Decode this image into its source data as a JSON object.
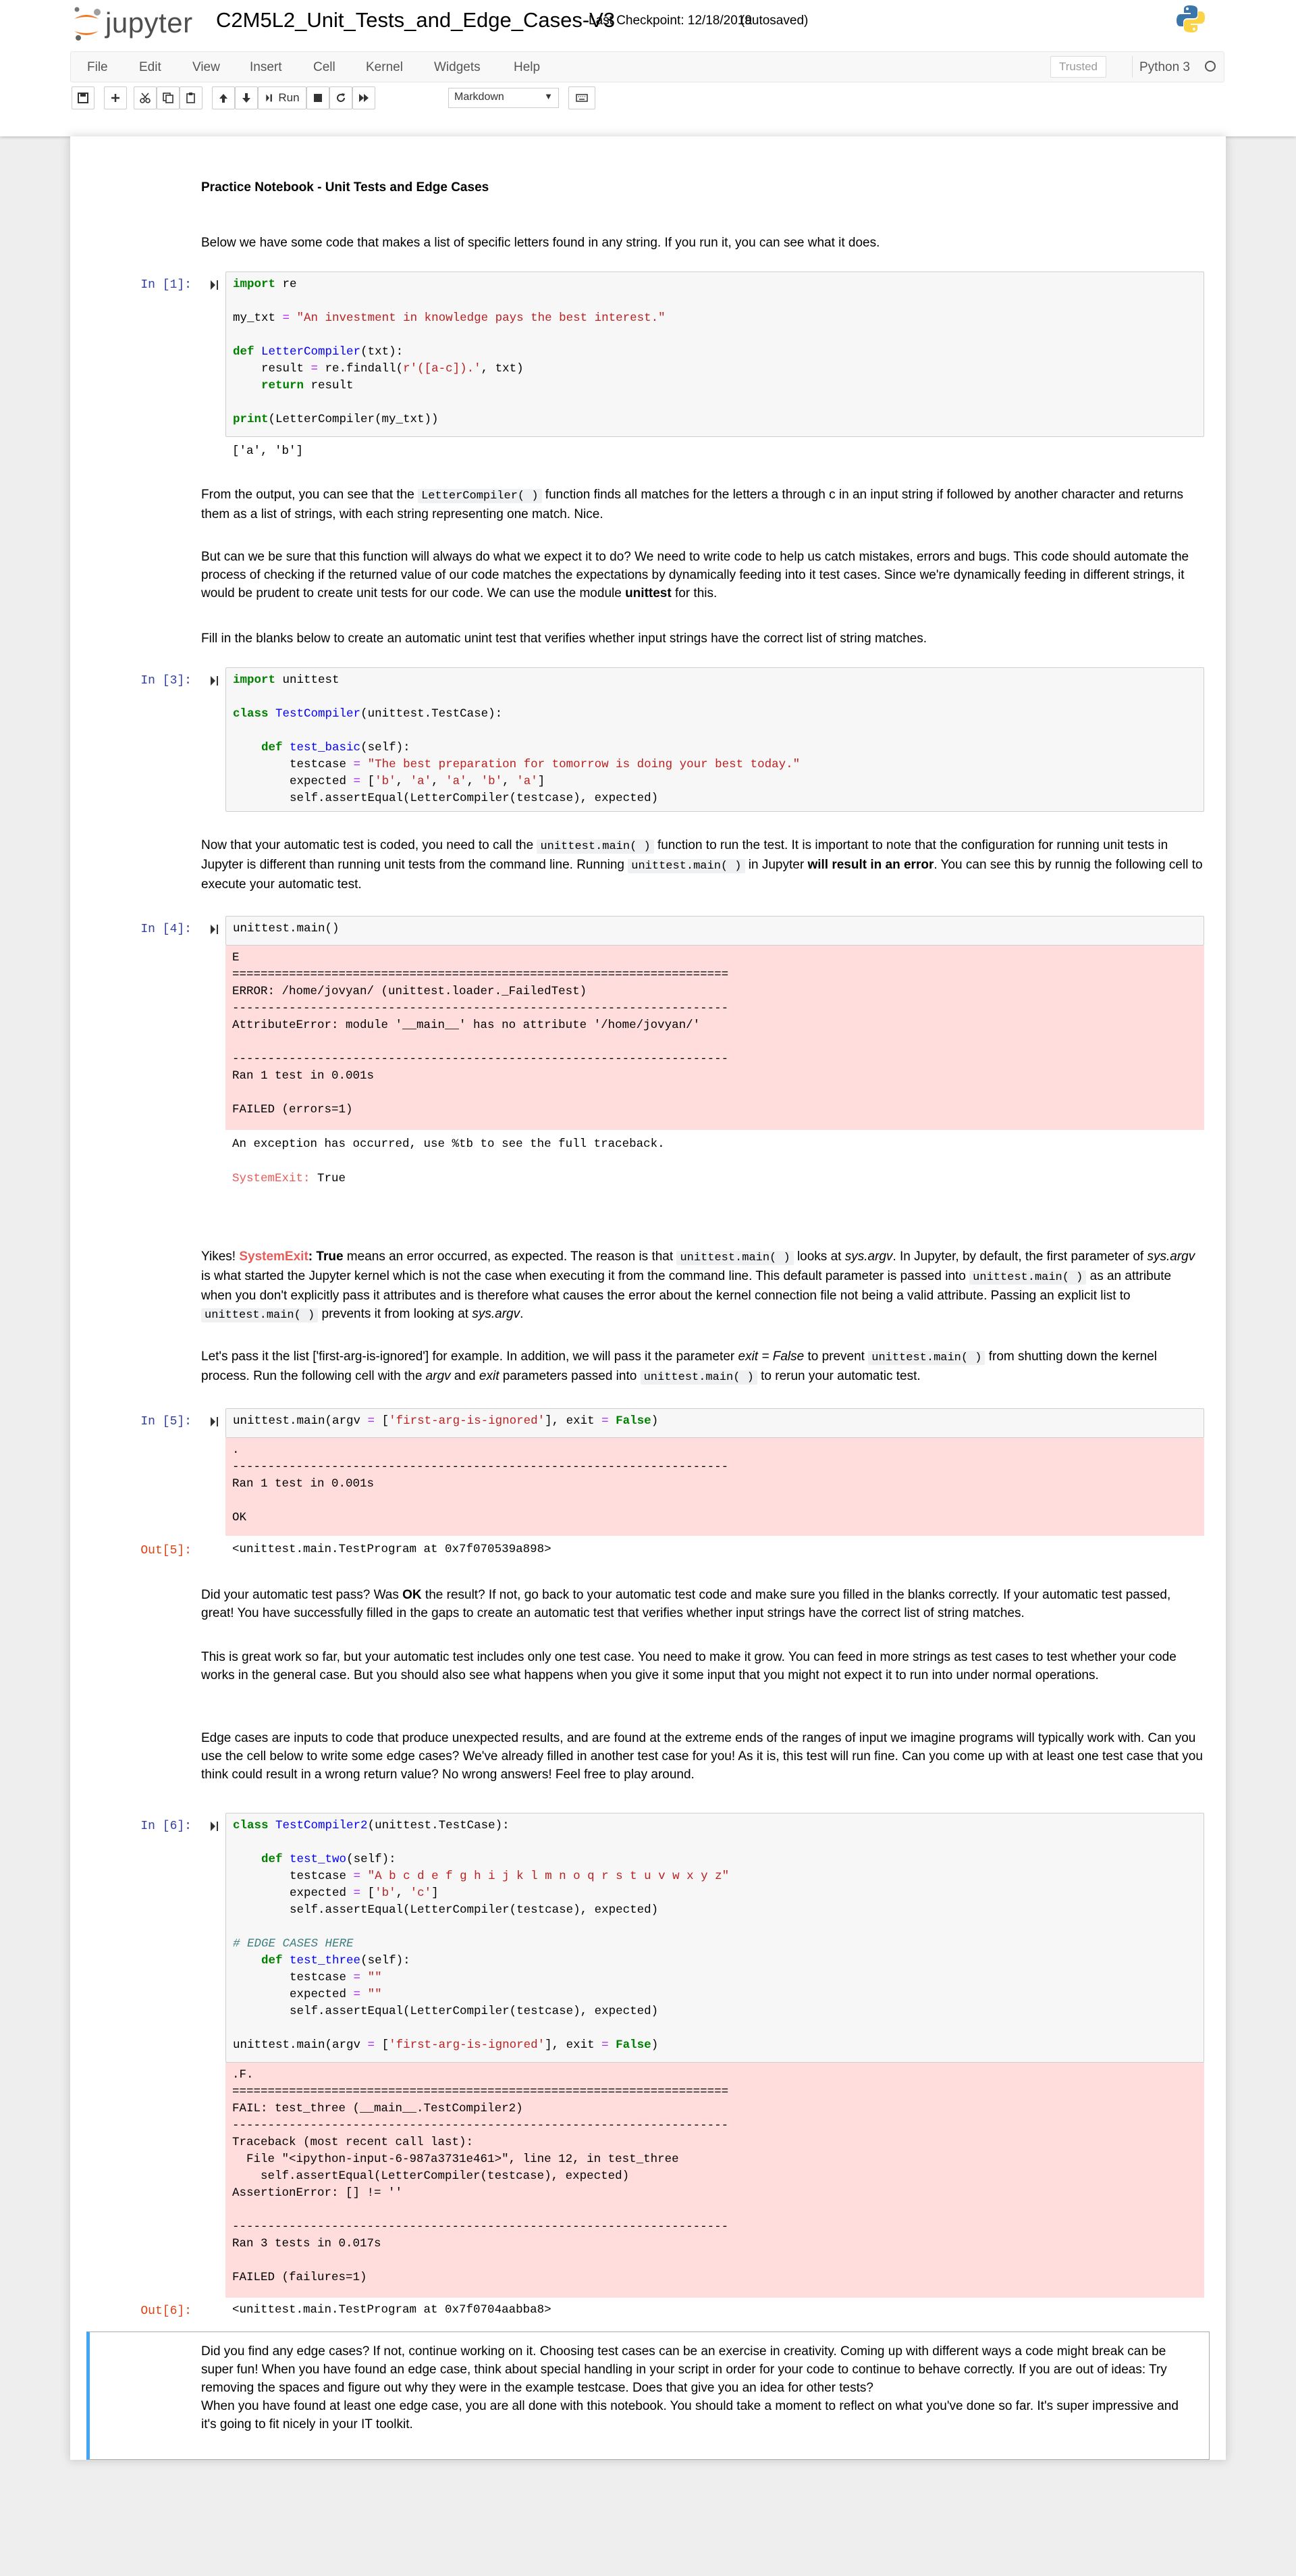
{
  "header": {
    "logo_text": "jupyter",
    "notebook_name": "C2M5L2_Unit_Tests_and_Edge_Cases-V3",
    "checkpoint": "Last Checkpoint: 12/18/2019",
    "autosave": "(autosaved)"
  },
  "menu": {
    "items": [
      "File",
      "Edit",
      "View",
      "Insert",
      "Cell",
      "Kernel",
      "Widgets",
      "Help"
    ],
    "trusted": "Trusted",
    "kernel": "Python 3"
  },
  "toolbar": {
    "run_label": "Run",
    "cell_type": "Markdown",
    "icons": [
      "save-icon",
      "plus-icon",
      "cut-icon",
      "copy-icon",
      "paste-icon",
      "arrow-up-icon",
      "arrow-down-icon",
      "run-icon",
      "stop-icon",
      "restart-icon",
      "fast-forward-icon",
      "keyboard-icon"
    ]
  },
  "cells": {
    "title": "Practice Notebook - Unit Tests and Edge Cases",
    "intro": "Below we have some code that makes a list of specific letters found in any string. If you run it, you can see what it does.",
    "c1_prompt": "In [1]:",
    "c1_out": "['a', 'b']",
    "md2_a": "From the output, you can see that the ",
    "md2_code": "LetterCompiler( )",
    "md2_b": " function finds all matches for the letters a through c in an input string if followed by another character and returns them as a list of strings, with each string representing one match. Nice.",
    "md3_a": "But can we be sure that this function will always do what we expect it to do? We need to write code to help us catch mistakes, errors and bugs. This code should automate the process of checking if the returned value of our code matches the expectations by dynamically feeding into it test cases. Since we're dynamically feeding in different strings, it would be prudent to create unit tests for our code. We can use the module ",
    "md3_bold": "unittest",
    "md3_b": " for this.",
    "md4": "Fill in the blanks below to create an automatic unint test that verifies whether input strings have the correct list of string matches.",
    "c3_prompt": "In [3]:",
    "md5_a": "Now that your automatic test is coded, you need to call the ",
    "md5_code1": "unittest.main( )",
    "md5_b": " function to run the test. It is important to note that the configuration for running unit tests in Jupyter is different than running unit tests from the command line. Running ",
    "md5_code2": "unittest.main( )",
    "md5_c": " in Jupyter ",
    "md5_bold": "will result in an error",
    "md5_d": ". You can see this by runnig the following cell to execute your automatic test.",
    "c4_prompt": "In [4]:",
    "c4_code": "unittest.main()",
    "c4_stderr": "E\n======================================================================\nERROR: /home/jovyan/ (unittest.loader._FailedTest)\n----------------------------------------------------------------------\nAttributeError: module '__main__' has no attribute '/home/jovyan/'\n\n----------------------------------------------------------------------\nRan 1 test in 0.001s\n\nFAILED (errors=1)",
    "c4_exception": "An exception has occurred, use %tb to see the full traceback.",
    "c4_sysexit_name": "SystemExit:",
    "c4_sysexit_val": " True",
    "md6_a": "Yikes! ",
    "md6_sysexit": "SystemExit",
    "md6_colon": ": True",
    "md6_b": " means an error occurred, as expected. The reason is that ",
    "md6_code1": "unittest.main( )",
    "md6_c": " looks at ",
    "md6_em1": "sys.argv",
    "md6_d": ". In Jupyter, by default, the first parameter of ",
    "md6_em2": "sys.argv",
    "md6_e": " is what started the Jupyter kernel which is not the case when executing it from the command line. This default parameter is passed into ",
    "md6_code2": "unittest.main( )",
    "md6_f": " as an attribute when you don't explicitly pass it attributes and is therefore what causes the error about the kernel connection file not being a valid attribute. Passing an explicit list to ",
    "md6_code3": "unittest.main( )",
    "md6_g": " prevents it from looking at ",
    "md6_em3": "sys.argv",
    "md6_h": ".",
    "md7_a": "Let's pass it the list ['first-arg-is-ignored'] for example. In addition, we will pass it the parameter ",
    "md7_em1": "exit = False",
    "md7_b": " to prevent ",
    "md7_code1": "unittest.main( )",
    "md7_c": " from shutting down the kernel process. Run the following cell with the ",
    "md7_em2": "argv",
    "md7_d": " and ",
    "md7_em3": "exit",
    "md7_e": " parameters passed into ",
    "md7_code2": "unittest.main( )",
    "md7_f": " to rerun your automatic test.",
    "c5_prompt": "In [5]:",
    "c5_stderr": ".\n----------------------------------------------------------------------\nRan 1 test in 0.001s\n\nOK",
    "c5_out_prompt": "Out[5]:",
    "c5_out": "<unittest.main.TestProgram at 0x7f070539a898>",
    "md8_a": "Did your automatic test pass? Was ",
    "md8_bold": "OK",
    "md8_b": " the result? If not, go back to your automatic test code and make sure you filled in the blanks correctly. If your automatic test passed, great! You have successfully filled in the gaps to create an automatic test that verifies whether input strings have the correct list of string matches.",
    "md9": "This is great work so far, but your automatic test includes only one test case. You need to make it grow. You can feed in more strings as test cases to test whether your code works in the general case. But you should also see what happens when you give it some input that you might not expect it to run into under normal operations.",
    "md10": "Edge cases are inputs to code that produce unexpected results, and are found at the extreme ends of the ranges of input we imagine programs will typically work with. Can you use the cell below to write some edge cases? We've already filled in another test case for you! As it is, this test will run fine. Can you come up with at least one test case that you think could result in a wrong return value? No wrong answers! Feel free to play around.",
    "c6_prompt": "In [6]:",
    "c6_stderr": ".F.\n======================================================================\nFAIL: test_three (__main__.TestCompiler2)\n----------------------------------------------------------------------\nTraceback (most recent call last):\n  File \"<ipython-input-6-987a3731e461>\", line 12, in test_three\n    self.assertEqual(LetterCompiler(testcase), expected)\nAssertionError: [] != ''\n\n----------------------------------------------------------------------\nRan 3 tests in 0.017s\n\nFAILED (failures=1)",
    "c6_out_prompt": "Out[6]:",
    "c6_out": "<unittest.main.TestProgram at 0x7f0704aabba8>",
    "md11_a": "Did you find any edge cases? If not, continue working on it. Choosing test cases can be an exercise in creativity. Coming up with different ways a code might break can be super fun! When you have found an edge case, think about special handling in your script in order for your code to continue to behave correctly. If you are out of ideas: Try removing the spaces and figure out why they were in the example testcase. Does that give you an idea for other tests?",
    "md11_b": "When you have found at least one edge case, you are all done with this notebook. You should take a moment to reflect on what you've done so far. It's super impressive and it's going to fit nicely in your IT toolkit."
  }
}
